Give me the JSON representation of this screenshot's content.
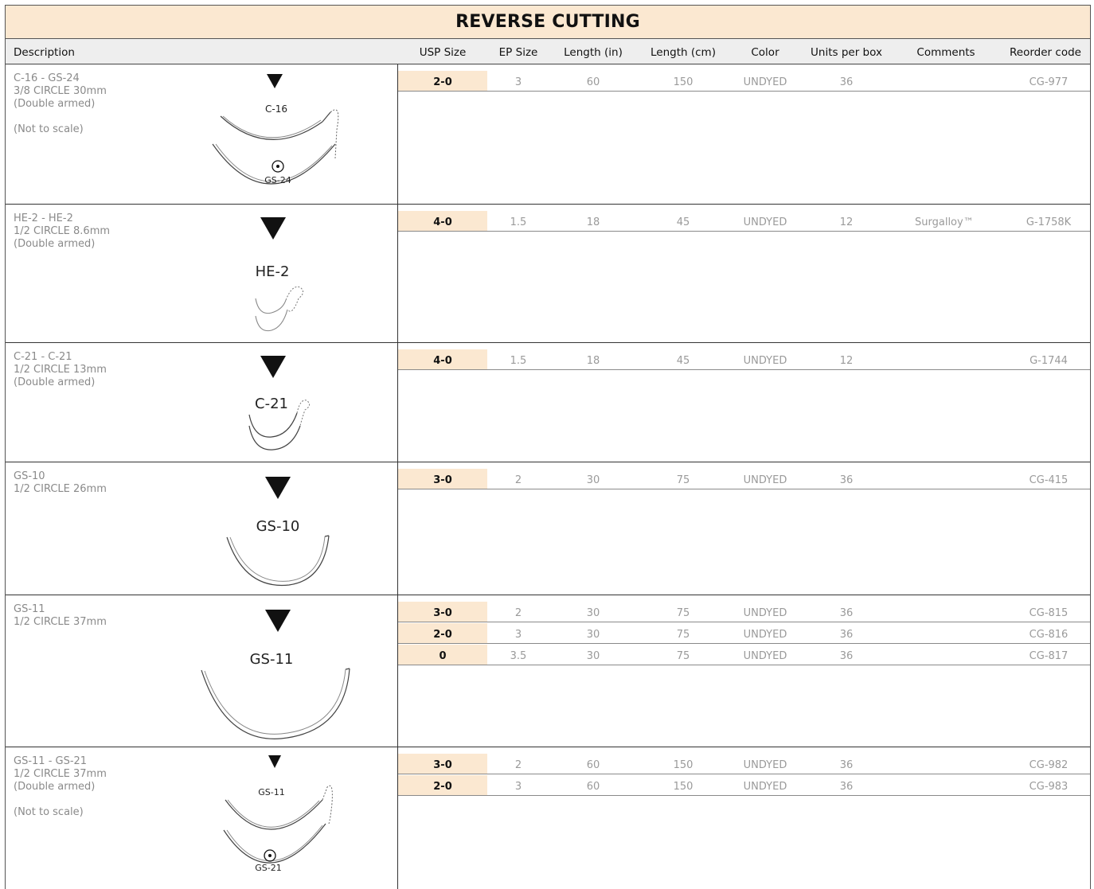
{
  "title": "REVERSE CUTTING",
  "headers": {
    "description": "Description",
    "usp_size": "USP Size",
    "ep_size": "EP Size",
    "length_in": "Length (in)",
    "length_cm": "Length (cm)",
    "color": "Color",
    "units_per_box": "Units per box",
    "comments": "Comments",
    "reorder_code": "Reorder code"
  },
  "sections": [
    {
      "desc": [
        "C-16 - GS-24",
        "3/8 CIRCLE 30mm",
        "(Double armed)",
        "",
        "(Not to scale)"
      ],
      "needle_labels": [
        "C-16",
        "GS-24"
      ],
      "rows": [
        {
          "usp": "2-0",
          "ep": "3",
          "in": "60",
          "cm": "150",
          "color": "UNDYED",
          "units": "36",
          "comments": "",
          "code": "CG-977"
        }
      ]
    },
    {
      "desc": [
        "HE-2 - HE-2",
        "1/2 CIRCLE 8.6mm",
        "(Double armed)"
      ],
      "needle_labels": [
        "HE-2"
      ],
      "rows": [
        {
          "usp": "4-0",
          "ep": "1.5",
          "in": "18",
          "cm": "45",
          "color": "UNDYED",
          "units": "12",
          "comments": "Surgalloy™",
          "code": "G-1758K"
        }
      ]
    },
    {
      "desc": [
        "C-21 - C-21",
        "1/2 CIRCLE 13mm",
        "(Double armed)"
      ],
      "needle_labels": [
        "C-21"
      ],
      "rows": [
        {
          "usp": "4-0",
          "ep": "1.5",
          "in": "18",
          "cm": "45",
          "color": "UNDYED",
          "units": "12",
          "comments": "",
          "code": "G-1744"
        }
      ]
    },
    {
      "desc": [
        "GS-10",
        "1/2 CIRCLE 26mm"
      ],
      "needle_labels": [
        "GS-10"
      ],
      "rows": [
        {
          "usp": "3-0",
          "ep": "2",
          "in": "30",
          "cm": "75",
          "color": "UNDYED",
          "units": "36",
          "comments": "",
          "code": "CG-415"
        }
      ]
    },
    {
      "desc": [
        "GS-11",
        "1/2 CIRCLE 37mm"
      ],
      "needle_labels": [
        "GS-11"
      ],
      "rows": [
        {
          "usp": "3-0",
          "ep": "2",
          "in": "30",
          "cm": "75",
          "color": "UNDYED",
          "units": "36",
          "comments": "",
          "code": "CG-815"
        },
        {
          "usp": "2-0",
          "ep": "3",
          "in": "30",
          "cm": "75",
          "color": "UNDYED",
          "units": "36",
          "comments": "",
          "code": "CG-816"
        },
        {
          "usp": "0",
          "ep": "3.5",
          "in": "30",
          "cm": "75",
          "color": "UNDYED",
          "units": "36",
          "comments": "",
          "code": "CG-817"
        }
      ]
    },
    {
      "desc": [
        "GS-11 - GS-21",
        "1/2 CIRCLE 37mm",
        "(Double armed)",
        "",
        "(Not to scale)"
      ],
      "needle_labels": [
        "GS-11",
        "GS-21"
      ],
      "rows": [
        {
          "usp": "3-0",
          "ep": "2",
          "in": "60",
          "cm": "150",
          "color": "UNDYED",
          "units": "36",
          "comments": "",
          "code": "CG-982"
        },
        {
          "usp": "2-0",
          "ep": "3",
          "in": "60",
          "cm": "150",
          "color": "UNDYED",
          "units": "36",
          "comments": "",
          "code": "CG-983"
        }
      ]
    }
  ]
}
